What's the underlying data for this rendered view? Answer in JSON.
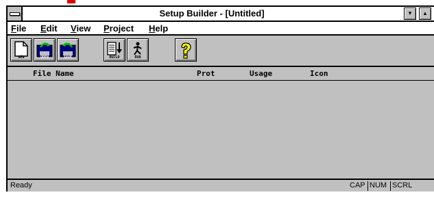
{
  "window": {
    "title": "Setup Builder - [Untitled]",
    "minimize_glyph": "▾",
    "maximize_glyph": "▴"
  },
  "menubar": {
    "items": [
      {
        "key": "F",
        "rest": "ile"
      },
      {
        "key": "E",
        "rest": "dit"
      },
      {
        "key": "V",
        "rest": "iew"
      },
      {
        "key": "P",
        "rest": "roject"
      },
      {
        "key": "H",
        "rest": "elp"
      }
    ]
  },
  "toolbar": {
    "buttons": [
      {
        "icon": "new-file-icon",
        "caption": "NEW"
      },
      {
        "icon": "open-file-icon",
        "caption": "OPEN"
      },
      {
        "icon": "save-file-icon",
        "caption": "SAVE"
      },
      {
        "icon": "build-icon",
        "caption": "BUILD"
      },
      {
        "icon": "run-icon",
        "caption": "RUN"
      },
      {
        "icon": "help-icon",
        "caption": ""
      }
    ]
  },
  "columns": {
    "file_name": "File Name",
    "prot": "Prot",
    "usage": "Usage",
    "icon": "Icon"
  },
  "statusbar": {
    "text": "Ready",
    "cap": "CAP",
    "num": "NUM",
    "scrl": "SCRL"
  },
  "colors": {
    "window_bg": "#c0c0c0",
    "title_bg": "#ffffff",
    "accent_red": "#e00000",
    "icon_blue": "#000080",
    "icon_green": "#008000",
    "help_yellow": "#ffff00"
  }
}
